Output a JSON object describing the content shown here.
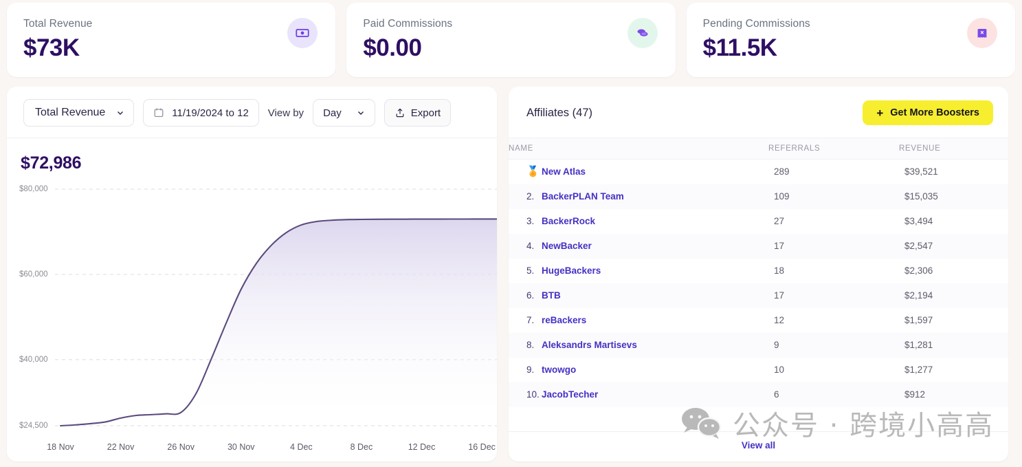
{
  "kpis": [
    {
      "label": "Total Revenue",
      "value": "$73K",
      "icon": "banknote-icon",
      "tint": "violet"
    },
    {
      "label": "Paid Commissions",
      "value": "$0.00",
      "icon": "coins-icon",
      "tint": "green"
    },
    {
      "label": "Pending Commissions",
      "value": "$11.5K",
      "icon": "receipt-icon",
      "tint": "pink"
    }
  ],
  "chart_panel": {
    "metric_select": "Total Revenue",
    "date_range": "11/19/2024 to 12",
    "view_by_label": "View by",
    "view_by_value": "Day",
    "export_label": "Export",
    "total": "$72,986"
  },
  "chart_data": {
    "type": "area",
    "title": "$72,986",
    "xlabel": "",
    "ylabel": "",
    "ylim": [
      24500,
      80000
    ],
    "grid": true,
    "legend": null,
    "ytick_labels": [
      "$80,000",
      "$60,000",
      "$40,000",
      "$24,500"
    ],
    "ytick_values": [
      80000,
      60000,
      40000,
      24500
    ],
    "xtick_labels": [
      "18 Nov",
      "22 Nov",
      "26 Nov",
      "30 Nov",
      "4 Dec",
      "8 Dec",
      "12 Dec",
      "16 Dec"
    ],
    "line_color": "#5b4a7e",
    "fill_top_color": "#ddd7ee",
    "series": [
      {
        "name": "Total Revenue",
        "x": [
          "18 Nov",
          "19 Nov",
          "20 Nov",
          "21 Nov",
          "22 Nov",
          "23 Nov",
          "24 Nov",
          "25 Nov",
          "26 Nov",
          "27 Nov",
          "28 Nov",
          "29 Nov",
          "30 Nov",
          "1 Dec",
          "2 Dec",
          "3 Dec",
          "4 Dec",
          "5 Dec",
          "6 Dec",
          "7 Dec",
          "8 Dec",
          "9 Dec",
          "10 Dec",
          "11 Dec",
          "12 Dec",
          "13 Dec",
          "14 Dec",
          "15 Dec",
          "16 Dec",
          "17 Dec"
        ],
        "values": [
          24500,
          24700,
          25000,
          25400,
          26300,
          26900,
          27100,
          27300,
          27600,
          32000,
          40000,
          48500,
          56500,
          62500,
          66800,
          69800,
          71600,
          72400,
          72700,
          72850,
          72900,
          72930,
          72950,
          72960,
          72970,
          72975,
          72980,
          72983,
          72985,
          72986
        ]
      }
    ]
  },
  "affiliates_panel": {
    "title": "Affiliates (47)",
    "boost_button": "Get More Boosters",
    "columns": [
      "NAME",
      "REFERRALS",
      "REVENUE"
    ],
    "view_all": "View all",
    "rows": [
      {
        "rank": "🏅",
        "name": "New Atlas",
        "referrals": "289",
        "revenue": "$39,521"
      },
      {
        "rank": "2.",
        "name": "BackerPLAN Team",
        "referrals": "109",
        "revenue": "$15,035"
      },
      {
        "rank": "3.",
        "name": "BackerRock",
        "referrals": "27",
        "revenue": "$3,494"
      },
      {
        "rank": "4.",
        "name": "NewBacker",
        "referrals": "17",
        "revenue": "$2,547"
      },
      {
        "rank": "5.",
        "name": "HugeBackers",
        "referrals": "18",
        "revenue": "$2,306"
      },
      {
        "rank": "6.",
        "name": "BTB",
        "referrals": "17",
        "revenue": "$2,194"
      },
      {
        "rank": "7.",
        "name": "reBackers",
        "referrals": "12",
        "revenue": "$1,597"
      },
      {
        "rank": "8.",
        "name": "Aleksandrs Martisevs",
        "referrals": "9",
        "revenue": "$1,281"
      },
      {
        "rank": "9.",
        "name": "twowgo",
        "referrals": "10",
        "revenue": "$1,277"
      },
      {
        "rank": "10.",
        "name": "JacobTecher",
        "referrals": "6",
        "revenue": "$912"
      }
    ]
  },
  "watermark": {
    "text": "公众号 · 跨境小高高"
  },
  "colors": {
    "accent_purple": "#4331c4",
    "deep_purple": "#2e0f63",
    "yellow": "#f7ee2f",
    "page_bg": "#faf6f4",
    "chart_line": "#5b4a7e"
  }
}
